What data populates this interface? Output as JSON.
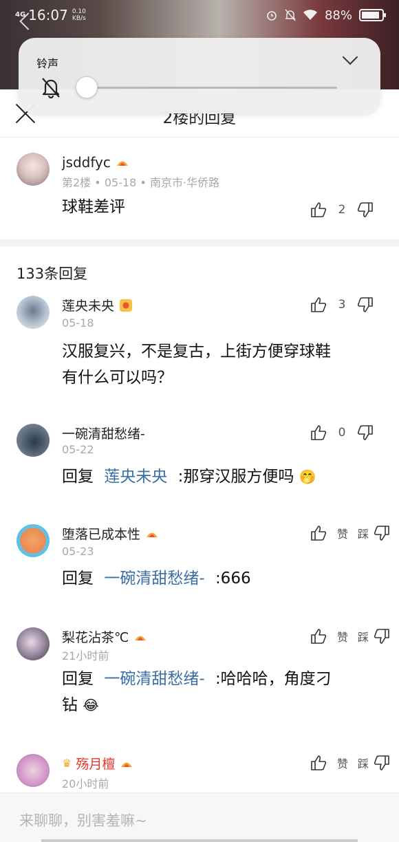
{
  "status": {
    "network": "4G",
    "time": "16:07",
    "speed_value": "0.10",
    "speed_unit": "KB/s",
    "battery": "88%",
    "battery_level": 0.88
  },
  "volume_panel": {
    "label": "铃声",
    "level": 0
  },
  "sheet": {
    "title": "2楼的回复"
  },
  "main_comment": {
    "username": "jsddfyc",
    "floor": "第2楼",
    "date": "05-18",
    "location": "南京市·华侨路",
    "text": "球鞋差评",
    "likes": "2"
  },
  "reply_count": "133条回复",
  "replies": [
    {
      "username": "莲央未央",
      "time": "05-18",
      "text_lines": [
        "汉服复兴，不是复古，上街方便穿球鞋",
        "有什么可以吗？"
      ],
      "likes": "3"
    },
    {
      "username": "一碗清甜愁绪-",
      "time": "05-22",
      "reply_prefix": "回复",
      "reply_to": "莲央未央",
      "text": ":那穿汉服方便吗",
      "emoji": "🤭",
      "likes": "0"
    },
    {
      "username": "堕落已成本性",
      "time": "05-23",
      "reply_prefix": "回复",
      "reply_to": "一碗清甜愁绪-",
      "text": ":666",
      "likes": "赞"
    },
    {
      "username": "梨花沾茶℃",
      "time": "21小时前",
      "reply_prefix": "回复",
      "reply_to": "一碗清甜愁绪-",
      "text": ":哈哈哈，角度刁",
      "text_line2": "钻",
      "emoji": "😂",
      "likes": "赞"
    },
    {
      "username": "殇月檀",
      "time": "20小时前",
      "likes": "赞"
    }
  ],
  "dislike_label": "踩",
  "input": {
    "placeholder": "来聊聊，别害羞嘛~"
  },
  "colors": {
    "link": "#3a6ea5",
    "vip_name": "#e8372c",
    "meta": "#a8a8a8"
  }
}
